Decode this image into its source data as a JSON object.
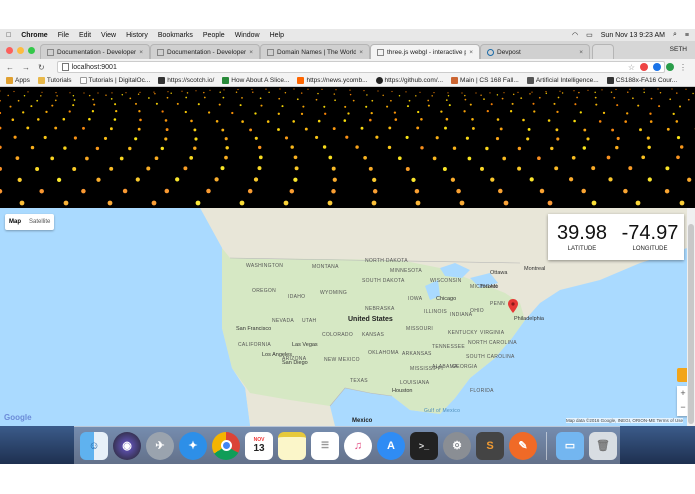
{
  "menubar": {
    "apple": "",
    "app": "Chrome",
    "items": [
      "File",
      "Edit",
      "View",
      "History",
      "Bookmarks",
      "People",
      "Window",
      "Help"
    ],
    "clock": "Sun Nov 13  9:23 AM"
  },
  "tabs": [
    {
      "label": "Documentation - Developer Fo",
      "active": false
    },
    {
      "label": "Documentation - Developer Fo",
      "active": false
    },
    {
      "label": "Domain Names | The World's",
      "active": false
    },
    {
      "label": "three.js webgl - interactive pa",
      "active": true
    },
    {
      "label": "Devpost",
      "active": false
    }
  ],
  "profile": "SETH",
  "toolbar": {
    "url": "localhost:9001"
  },
  "bookmarks": [
    {
      "label": "Apps",
      "color": "#e0a030"
    },
    {
      "label": "Tutorials",
      "color": "#e8b84a"
    },
    {
      "label": "Tutorials | DigitalOc...",
      "color": "#cccccc"
    },
    {
      "label": "https://scotch.io/",
      "color": "#333333"
    },
    {
      "label": "How About A Slice...",
      "color": "#2a8a3a"
    },
    {
      "label": "https://news.ycomb...",
      "color": "#ff6600"
    },
    {
      "label": "https://github.com/...",
      "color": "#222222"
    },
    {
      "label": "Main | CS 168 Fall...",
      "color": "#cc6633"
    },
    {
      "label": "Artificial Intelligence...",
      "color": "#555555"
    },
    {
      "label": "CS188x-FA16 Cour...",
      "color": "#333333"
    }
  ],
  "map": {
    "type_buttons": {
      "map": "Map",
      "satellite": "Satellite"
    },
    "latitude": "39.98",
    "longitude": "-74.97",
    "latitude_label": "LATITUDE",
    "longitude_label": "LONGITUDE",
    "country_label": "United States",
    "country_label_2": "Mexico",
    "states": [
      "WASHINGTON",
      "MONTANA",
      "NORTH DAKOTA",
      "MINNESOTA",
      "SOUTH DAKOTA",
      "WISCONSIN",
      "MICHIGAN",
      "OREGON",
      "IDAHO",
      "WYOMING",
      "NEBRASKA",
      "IOWA",
      "NEVADA",
      "UTAH",
      "COLORADO",
      "KANSAS",
      "MISSOURI",
      "ILLINOIS",
      "INDIANA",
      "OHIO",
      "PENN",
      "CALIFORNIA",
      "ARIZONA",
      "NEW MEXICO",
      "OKLAHOMA",
      "ARKANSAS",
      "TENNESSEE",
      "KENTUCKY",
      "VIRGINIA",
      "NORTH CAROLINA",
      "SOUTH CAROLINA",
      "GEORGIA",
      "ALABAMA",
      "MISSISSIPPI",
      "LOUISIANA",
      "TEXAS",
      "FLORIDA"
    ],
    "cities": [
      "Ottawa",
      "Montreal",
      "Toronto",
      "Chicago",
      "Philadelphia",
      "San Francisco",
      "Las Vegas",
      "Los Angeles",
      "San Diego",
      "Houston"
    ],
    "water": [
      "Gulf of Mexico"
    ],
    "google_logo": "Google",
    "attribution": "Map data ©2016 Google, INEGI, ORION-ME   Terms of Use",
    "zoom_in": "+",
    "zoom_out": "−"
  },
  "dock": [
    "Finder",
    "Siri",
    "Launchpad",
    "Safari",
    "Chrome",
    "Calendar",
    "Notes",
    "Reminders",
    "iTunes",
    "App Store",
    "Terminal",
    "System Preferences",
    "Sublime Text",
    "Instruments",
    "Downloads",
    "Trash"
  ],
  "calendar": {
    "month": "NOV",
    "day": "13"
  }
}
